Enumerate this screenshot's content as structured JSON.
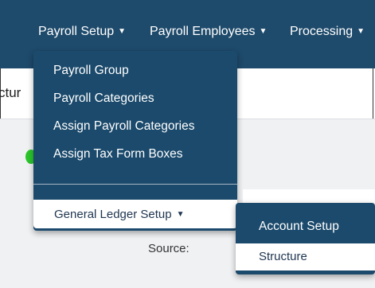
{
  "navbar": {
    "items": [
      {
        "label": "Payroll Setup"
      },
      {
        "label": "Payroll Employees"
      },
      {
        "label": "Processing"
      }
    ],
    "caret": "▼"
  },
  "page": {
    "title_fragment": "ctur",
    "source_label": "Source:"
  },
  "payroll_setup_menu": {
    "items": [
      {
        "label": "Payroll Group"
      },
      {
        "label": "Payroll Categories"
      },
      {
        "label": "Assign Payroll Categories"
      },
      {
        "label": "Assign Tax Form Boxes"
      }
    ],
    "general_ledger": {
      "label": "General Ledger Setup",
      "caret": "▼"
    }
  },
  "general_ledger_submenu": {
    "items": [
      {
        "label": "Account Setup"
      },
      {
        "label": "Structure"
      }
    ]
  },
  "colors": {
    "navbar": "#1e4a6b",
    "menu": "#1b4a6c",
    "status_dot": "#2bc52b"
  }
}
